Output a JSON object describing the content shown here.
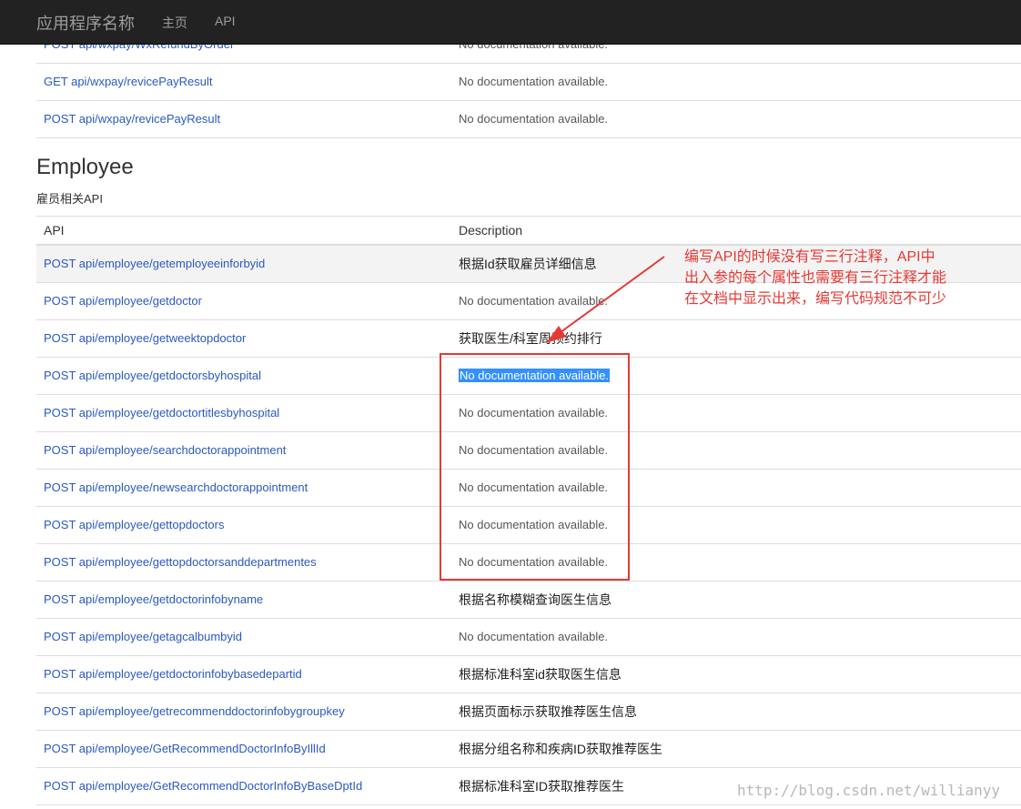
{
  "navbar": {
    "brand": "应用程序名称",
    "links": [
      "主页",
      "API"
    ]
  },
  "top_rows": [
    {
      "api": "POST api/wxpay/WxRefundByOrder",
      "description": "No documentation available."
    },
    {
      "api": "GET api/wxpay/revicePayResult",
      "description": "No documentation available."
    },
    {
      "api": "POST api/wxpay/revicePayResult",
      "description": "No documentation available."
    }
  ],
  "section": {
    "title": "Employee",
    "subtitle": "雇员相关API",
    "headers": {
      "api": "API",
      "description": "Description"
    }
  },
  "employee_rows": [
    {
      "api": "POST api/employee/getemployeeinforbyid",
      "description": "根据Id获取雇员详细信息"
    },
    {
      "api": "POST api/employee/getdoctor",
      "description": "No documentation available."
    },
    {
      "api": "POST api/employee/getweektopdoctor",
      "description": "获取医生/科室周预约排行"
    },
    {
      "api": "POST api/employee/getdoctorsbyhospital",
      "description": "No documentation available."
    },
    {
      "api": "POST api/employee/getdoctortitlesbyhospital",
      "description": "No documentation available."
    },
    {
      "api": "POST api/employee/searchdoctorappointment",
      "description": "No documentation available."
    },
    {
      "api": "POST api/employee/newsearchdoctorappointment",
      "description": "No documentation available."
    },
    {
      "api": "POST api/employee/gettopdoctors",
      "description": "No documentation available."
    },
    {
      "api": "POST api/employee/gettopdoctorsanddepartmentes",
      "description": "No documentation available."
    },
    {
      "api": "POST api/employee/getdoctorinfobyname",
      "description": "根据名称模糊查询医生信息"
    },
    {
      "api": "POST api/employee/getagcalbumbyid",
      "description": "No documentation available."
    },
    {
      "api": "POST api/employee/getdoctorinfobybasedepartid",
      "description": "根据标准科室id获取医生信息"
    },
    {
      "api": "POST api/employee/getrecommenddoctorinfobygroupkey",
      "description": "根据页面标示获取推荐医生信息"
    },
    {
      "api": "POST api/employee/GetRecommendDoctorInfoByIllId",
      "description": "根据分组名称和疾病ID获取推荐医生"
    },
    {
      "api": "POST api/employee/GetRecommendDoctorInfoByBaseDptId",
      "description": "根据标准科室ID获取推荐医生"
    }
  ],
  "annotation": {
    "lines": [
      "编写API的时候没有写三行注释，API中",
      "出入参的每个属性也需要有三行注释才能",
      "在文档中显示出来，编写代码规范不可少"
    ],
    "color": "#e53935"
  },
  "watermark": "http://blog.csdn.net/willianyy"
}
